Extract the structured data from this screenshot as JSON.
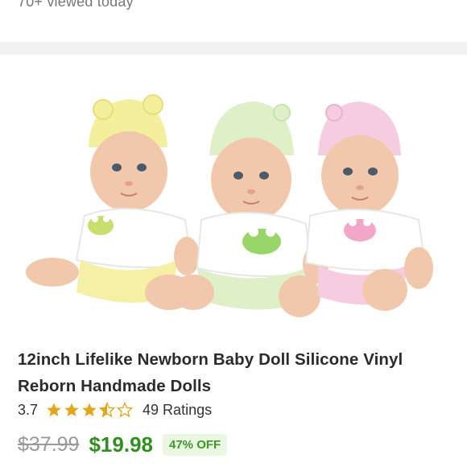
{
  "header": {
    "viewed_text": "70+ viewed today"
  },
  "product": {
    "title": "12inch Lifelike Newborn Baby Doll Silicone Vinyl Reborn Handmade Dolls",
    "rating": {
      "value": "3.7",
      "stars": 3.5,
      "count_text": "49 Ratings"
    },
    "price": {
      "original": "$37.99",
      "current": "$19.98",
      "discount": "47% OFF"
    },
    "image": {
      "subject": "three baby dolls with hats (yellow, green, pink)"
    }
  },
  "colors": {
    "price_green": "#2f8f1f",
    "star_gold": "#e3a61b",
    "discount_bg": "#e9f7e3"
  }
}
